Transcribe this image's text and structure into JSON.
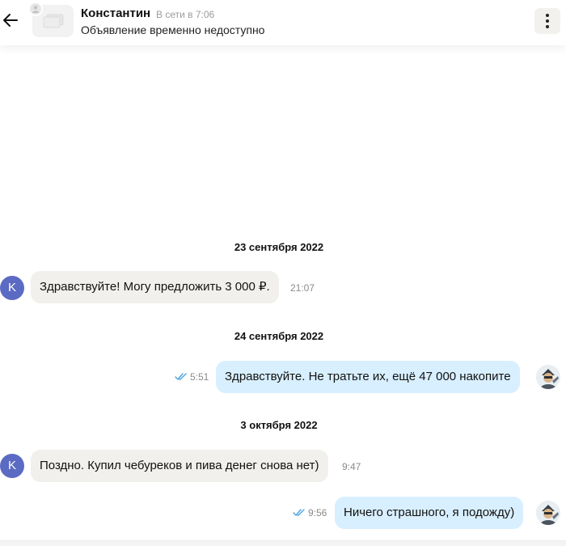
{
  "header": {
    "contact_name": "Константин",
    "online_status": "В сети в 7:06",
    "ad_status": "Объявление временно недоступно"
  },
  "icons": {
    "back": "arrow-left-icon",
    "menu": "more-dots-icon",
    "read": "double-check-icon"
  },
  "colors": {
    "incoming_bubble": "#f2f0ec",
    "outgoing_bubble": "#d8efff",
    "contact_avatar": "#5b6bc4",
    "read_checks": "#4aa3df"
  },
  "chat": {
    "dates": [
      "23 сентября 2022",
      "24 сентября 2022",
      "3 октября 2022"
    ],
    "messages": [
      {
        "direction": "in",
        "text": "Здравствуйте! Могу предложить 3 000 ₽.",
        "time": "21:07",
        "avatar_letter": "K"
      },
      {
        "direction": "out",
        "text": "Здравствуйте. Не тратьте их, ещё 47 000 накопите",
        "time": "5:51",
        "read": true
      },
      {
        "direction": "in",
        "text": "Поздно. Купил чебуреков и пива денег снова нет)",
        "time": "9:47",
        "avatar_letter": "K"
      },
      {
        "direction": "out",
        "text": "Ничего страшного, я подожду)",
        "time": "9:56",
        "read": true
      }
    ]
  }
}
